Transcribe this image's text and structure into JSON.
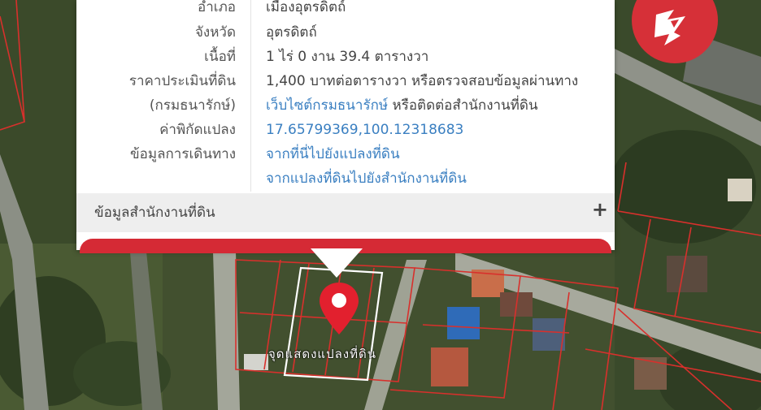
{
  "parcel_info": {
    "rows": [
      {
        "label": "อำเภอ",
        "value": "เมืองอุตรดิตถ์",
        "style": "text"
      },
      {
        "label": "จังหวัด",
        "value": "อุตรดิตถ์",
        "style": "text"
      },
      {
        "label": "เนื้อที่",
        "value": "1 ไร่ 0 งาน 39.4 ตารางวา",
        "style": "text"
      },
      {
        "label": "ราคาประเมินที่ดิน",
        "value": "1,400 บาทต่อตารางวา หรือตรวจสอบข้อมูลผ่านทาง",
        "style": "text"
      },
      {
        "label": "(กรมธนารักษ์)",
        "value_link": "เว็บไซต์กรมธนารักษ์",
        "value_suffix": " หรือติดต่อสำนักงานที่ดิน",
        "style": "mixed"
      },
      {
        "label": "ค่าพิกัดแปลง",
        "value": "17.65799369,100.12318683",
        "style": "link"
      },
      {
        "label": "ข้อมูลการเดินทาง",
        "value": "จากที่นี่ไปยังแปลงที่ดิน",
        "style": "link"
      },
      {
        "label": "",
        "value": "จากแปลงที่ดินไปยังสำนักงานที่ดิน",
        "style": "link"
      }
    ]
  },
  "land_office_section": {
    "label": "ข้อมูลสำนักงานที่ดิน",
    "toggle": "+"
  },
  "map": {
    "parcel_label": "จุดแสดงแปลงที่ดิน"
  },
  "icons": {
    "pin": "map-pin-icon",
    "logo": "brand-logo-icon",
    "expand": "plus-icon"
  },
  "colors": {
    "accent": "#d52a35",
    "link": "#3a7fc1",
    "parcel_lines": "#d8302c"
  }
}
